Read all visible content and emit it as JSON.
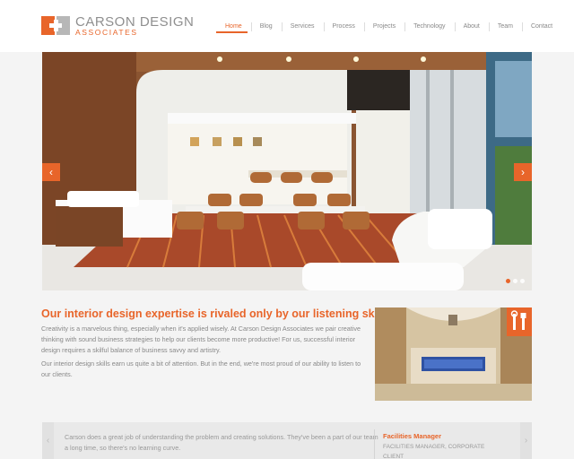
{
  "brand": {
    "name": "CARSON DESIGN",
    "subtitle": "ASSOCIATES",
    "accent": "#e8652a"
  },
  "nav": {
    "items": [
      "Home",
      "Blog",
      "Services",
      "Process",
      "Projects",
      "Technology",
      "About",
      "Team",
      "Contact"
    ],
    "active": "Home"
  },
  "hero": {
    "prev_icon": "chevron-left-icon",
    "next_icon": "chevron-right-icon",
    "slide_count": 3,
    "active_slide": 1
  },
  "intro": {
    "heading": "Our interior design expertise is rivaled only by our listening skills.",
    "paragraph1": "Creativity is a marvelous thing, especially when it's applied wisely. At Carson Design Associates we pair creative thinking with sound business strategies to help our clients become more productive! For us, successful interior design requires a skilful balance of business savvy and artistry.",
    "paragraph2": "Our interior design skills earn us quite a bit of attention. But in the end, we're most proud of our ability to listen to our clients.",
    "feature_icon": "tools-icon"
  },
  "testimonial": {
    "quote": "Carson does a great job of understanding the problem and creating solutions. They've been a part of our team a long time, so there's no learning curve.",
    "name": "Facilities Manager",
    "role": "FACILITIES MANAGER, CORPORATE CLIENT"
  }
}
